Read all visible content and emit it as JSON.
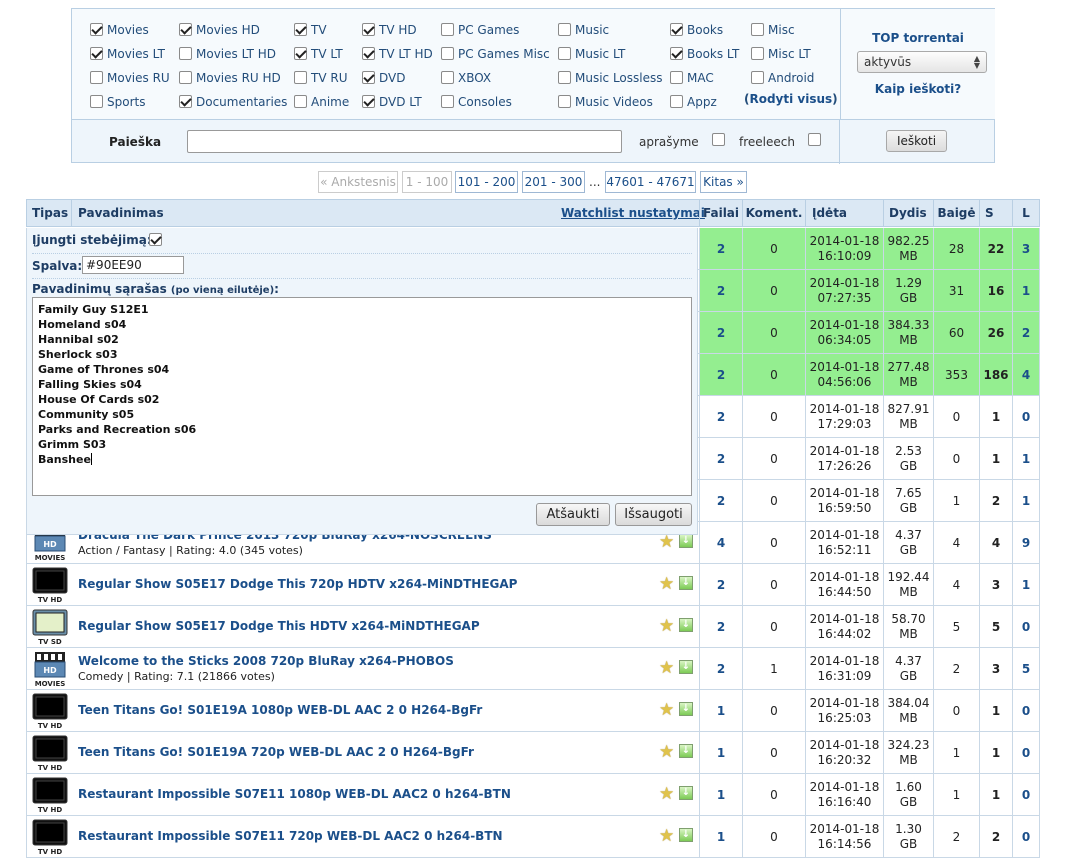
{
  "categories": [
    {
      "label": "Movies",
      "checked": true
    },
    {
      "label": "Movies HD",
      "checked": true
    },
    {
      "label": "TV",
      "checked": true
    },
    {
      "label": "TV HD",
      "checked": true
    },
    {
      "label": "PC Games",
      "checked": false
    },
    {
      "label": "Music",
      "checked": false
    },
    {
      "label": "Books",
      "checked": true
    },
    {
      "label": "Misc",
      "checked": false
    },
    {
      "label": "Movies LT",
      "checked": true
    },
    {
      "label": "Movies LT HD",
      "checked": false
    },
    {
      "label": "TV LT",
      "checked": true
    },
    {
      "label": "TV LT HD",
      "checked": true
    },
    {
      "label": "PC Games Misc",
      "checked": false
    },
    {
      "label": "Music LT",
      "checked": false
    },
    {
      "label": "Books LT",
      "checked": true
    },
    {
      "label": "Misc LT",
      "checked": false
    },
    {
      "label": "Movies RU",
      "checked": false
    },
    {
      "label": "Movies RU HD",
      "checked": false
    },
    {
      "label": "TV RU",
      "checked": false
    },
    {
      "label": "DVD",
      "checked": true
    },
    {
      "label": "XBOX",
      "checked": false
    },
    {
      "label": "Music Lossless",
      "checked": false
    },
    {
      "label": "MAC",
      "checked": false
    },
    {
      "label": "Android",
      "checked": false
    },
    {
      "label": "Sports",
      "checked": false
    },
    {
      "label": "Documentaries",
      "checked": true
    },
    {
      "label": "Anime",
      "checked": false
    },
    {
      "label": "DVD LT",
      "checked": true
    },
    {
      "label": "Consoles",
      "checked": false
    },
    {
      "label": "Music Videos",
      "checked": false
    },
    {
      "label": "Appz",
      "checked": false
    }
  ],
  "rodyti_visus": {
    "open": "(",
    "link": "Rodyti visus",
    "close": ")"
  },
  "top": {
    "title": "TOP torrentai",
    "select_value": "aktyvūs",
    "help": "Kaip ieškoti?"
  },
  "search": {
    "label": "Paieška",
    "value": "",
    "description_label": "aprašyme",
    "freeleech_label": "freeleech",
    "button": "Ieškoti"
  },
  "pager": {
    "prev": "« Ankstesnis",
    "current": "1 - 100",
    "pages": [
      "101 - 200",
      "201 - 300"
    ],
    "ellipsis": "...",
    "last": "47601 - 47671",
    "next": "Kitas »"
  },
  "table": {
    "headers": {
      "type": "Tipas",
      "name": "Pavadinimas",
      "watchlist": "Watchlist nustatymai",
      "files": "Failai",
      "comments": "Koment.",
      "added": "Įdėta",
      "size": "Dydis",
      "finished": "Baigė",
      "seeders": "S",
      "leechers": "L"
    },
    "rows": [
      {
        "title": "",
        "sub": "",
        "icon": "",
        "files": "2",
        "comments": "0",
        "date": "2014-01-18",
        "time": "16:10:09",
        "size": "982.25",
        "unit": "MB",
        "finished": "28",
        "s": "22",
        "l": "3",
        "highlight": true
      },
      {
        "title": "",
        "sub": "",
        "icon": "",
        "files": "2",
        "comments": "0",
        "date": "2014-01-18",
        "time": "07:27:35",
        "size": "1.29",
        "unit": "GB",
        "finished": "31",
        "s": "16",
        "l": "1",
        "highlight": true
      },
      {
        "title": "",
        "sub": "",
        "icon": "",
        "files": "2",
        "comments": "0",
        "date": "2014-01-18",
        "time": "06:34:05",
        "size": "384.33",
        "unit": "MB",
        "finished": "60",
        "s": "26",
        "l": "2",
        "highlight": true
      },
      {
        "title": "",
        "sub": "",
        "icon": "",
        "files": "2",
        "comments": "0",
        "date": "2014-01-18",
        "time": "04:56:06",
        "size": "277.48",
        "unit": "MB",
        "finished": "353",
        "s": "186",
        "l": "4",
        "highlight": true
      },
      {
        "title": "",
        "sub": "",
        "icon": "",
        "files": "2",
        "comments": "0",
        "date": "2014-01-18",
        "time": "17:29:03",
        "size": "827.91",
        "unit": "MB",
        "finished": "0",
        "s": "1",
        "l": "0",
        "highlight": false
      },
      {
        "title": "",
        "sub": "",
        "icon": "",
        "files": "2",
        "comments": "0",
        "date": "2014-01-18",
        "time": "17:26:26",
        "size": "2.53",
        "unit": "GB",
        "finished": "0",
        "s": "1",
        "l": "1",
        "highlight": false
      },
      {
        "title": "",
        "sub": "",
        "icon": "",
        "files": "2",
        "comments": "0",
        "date": "2014-01-18",
        "time": "16:59:50",
        "size": "7.65",
        "unit": "GB",
        "finished": "1",
        "s": "2",
        "l": "1",
        "highlight": false
      },
      {
        "title": "Dracula The Dark Prince 2013 720p BluRay x264-NOSCREENS",
        "sub": "Action / Fantasy | Rating: 4.0 (345 votes)",
        "icon": "HD MOVIES",
        "files": "4",
        "comments": "0",
        "date": "2014-01-18",
        "time": "16:52:11",
        "size": "4.37",
        "unit": "GB",
        "finished": "4",
        "s": "4",
        "l": "9",
        "highlight": false
      },
      {
        "title": "Regular Show S05E17 Dodge This 720p HDTV x264-MiNDTHEGAP",
        "sub": "",
        "icon": "TV HD",
        "files": "2",
        "comments": "0",
        "date": "2014-01-18",
        "time": "16:44:50",
        "size": "192.44",
        "unit": "MB",
        "finished": "4",
        "s": "3",
        "l": "1",
        "highlight": false
      },
      {
        "title": "Regular Show S05E17 Dodge This HDTV x264-MiNDTHEGAP",
        "sub": "",
        "icon": "TV SD",
        "files": "2",
        "comments": "0",
        "date": "2014-01-18",
        "time": "16:44:02",
        "size": "58.70",
        "unit": "MB",
        "finished": "5",
        "s": "5",
        "l": "0",
        "highlight": false
      },
      {
        "title": "Welcome to the Sticks 2008 720p BluRay x264-PHOBOS",
        "sub": "Comedy | Rating: 7.1 (21866 votes)",
        "icon": "HD MOVIES",
        "files": "2",
        "comments": "1",
        "date": "2014-01-18",
        "time": "16:31:09",
        "size": "4.37",
        "unit": "GB",
        "finished": "2",
        "s": "3",
        "l": "5",
        "highlight": false
      },
      {
        "title": "Teen Titans Go! S01E19A 1080p WEB-DL AAC 2 0 H264-BgFr",
        "sub": "",
        "icon": "TV HD",
        "files": "1",
        "comments": "0",
        "date": "2014-01-18",
        "time": "16:25:03",
        "size": "384.04",
        "unit": "MB",
        "finished": "0",
        "s": "1",
        "l": "0",
        "highlight": false
      },
      {
        "title": "Teen Titans Go! S01E19A 720p WEB-DL AAC 2 0 H264-BgFr",
        "sub": "",
        "icon": "TV HD",
        "files": "1",
        "comments": "0",
        "date": "2014-01-18",
        "time": "16:20:32",
        "size": "324.23",
        "unit": "MB",
        "finished": "1",
        "s": "1",
        "l": "0",
        "highlight": false
      },
      {
        "title": "Restaurant Impossible S07E11 1080p WEB-DL AAC2 0 h264-BTN",
        "sub": "",
        "icon": "TV HD",
        "files": "1",
        "comments": "0",
        "date": "2014-01-18",
        "time": "16:16:40",
        "size": "1.60",
        "unit": "GB",
        "finished": "1",
        "s": "1",
        "l": "0",
        "highlight": false
      },
      {
        "title": "Restaurant Impossible S07E11 720p WEB-DL AAC2 0 h264-BTN",
        "sub": "",
        "icon": "TV HD",
        "files": "1",
        "comments": "0",
        "date": "2014-01-18",
        "time": "16:14:56",
        "size": "1.30",
        "unit": "GB",
        "finished": "2",
        "s": "2",
        "l": "0",
        "highlight": false
      }
    ]
  },
  "watchlist": {
    "enable_label": "Įjungti stebėjimą:",
    "enabled": true,
    "color_label": "Spalva:",
    "color_value": "#90EE90",
    "names_label": "Pavadinimų sąrašas",
    "names_hint": "(po vieną eilutėje)",
    "names_colon": ":",
    "names": [
      "Family Guy S12E1",
      "Homeland s04",
      "Hannibal s02",
      "Sherlock s03",
      "Game of Thrones s04",
      "Falling Skies s04",
      "House Of Cards s02",
      "Community s05",
      "Parks and Recreation s06",
      "Grimm S03",
      "Banshee"
    ],
    "cancel": "Atšaukti",
    "save": "Išsaugoti"
  },
  "colors": {
    "highlight": "#94ee90",
    "link": "#1b4f8a",
    "header_bg": "#dbe8f4"
  },
  "icons": {
    "favorite": "star-icon",
    "download": "download-icon",
    "dropdown": "dropdown-arrow-icon"
  }
}
